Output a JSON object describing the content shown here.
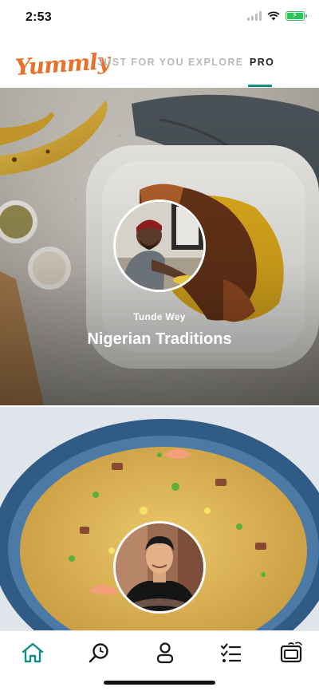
{
  "status_bar": {
    "time": "2:53"
  },
  "app": {
    "logo": "Yummly"
  },
  "nav_tabs": [
    {
      "label": "JUST FOR YOU",
      "active": false
    },
    {
      "label": "EXPLORE",
      "active": false
    },
    {
      "label": "PRO",
      "active": true
    }
  ],
  "colors": {
    "brand": "#e8702a",
    "accent": "#0f8f86"
  },
  "collections": [
    {
      "chef": "Tunde Wey",
      "title": "Nigerian Traditions"
    },
    {
      "chef": "",
      "title": ""
    }
  ],
  "bottom_nav": [
    {
      "name": "home-icon",
      "active": true
    },
    {
      "name": "search-icon",
      "active": false
    },
    {
      "name": "profile-icon",
      "active": false
    },
    {
      "name": "checklist-icon",
      "active": false
    },
    {
      "name": "smart-oven-icon",
      "active": false
    }
  ]
}
